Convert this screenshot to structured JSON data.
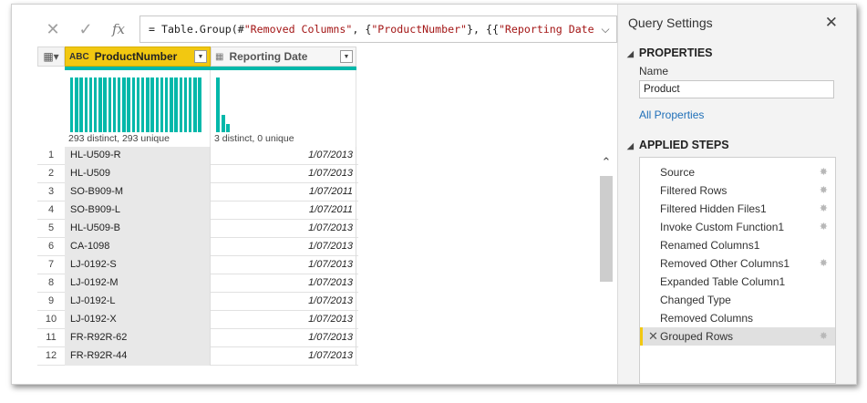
{
  "formula_bar": {
    "cancel_icon": "✕",
    "commit_icon": "✓",
    "fx_label": "fx",
    "formula_parts": [
      "= Table.Group(#",
      "\"Removed Columns\"",
      ", {",
      "\"ProductNumber\"",
      "}, {{",
      "\"Reporting Date\"",
      ","
    ],
    "expand_icon": "chevron-down-icon"
  },
  "table": {
    "columns": [
      {
        "type_icon": "ABC",
        "name": "ProductNumber",
        "selected": true,
        "profile_text": "293 distinct, 293 unique"
      },
      {
        "type_icon": "▦",
        "name": "Reporting Date",
        "selected": false,
        "profile_text": "3 distinct, 0 unique"
      }
    ],
    "col2_profile_levels": [
      1.0,
      0.32,
      0.15
    ],
    "rows": [
      {
        "n": "1",
        "product": "HL-U509-R",
        "date": "1/07/2013"
      },
      {
        "n": "2",
        "product": "HL-U509",
        "date": "1/07/2013"
      },
      {
        "n": "3",
        "product": "SO-B909-M",
        "date": "1/07/2011"
      },
      {
        "n": "4",
        "product": "SO-B909-L",
        "date": "1/07/2011"
      },
      {
        "n": "5",
        "product": "HL-U509-B",
        "date": "1/07/2013"
      },
      {
        "n": "6",
        "product": "CA-1098",
        "date": "1/07/2013"
      },
      {
        "n": "7",
        "product": "LJ-0192-S",
        "date": "1/07/2013"
      },
      {
        "n": "8",
        "product": "LJ-0192-M",
        "date": "1/07/2013"
      },
      {
        "n": "9",
        "product": "LJ-0192-L",
        "date": "1/07/2013"
      },
      {
        "n": "10",
        "product": "LJ-0192-X",
        "date": "1/07/2013"
      },
      {
        "n": "11",
        "product": "FR-R92R-62",
        "date": "1/07/2013"
      },
      {
        "n": "12",
        "product": "FR-R92R-44",
        "date": "1/07/2013"
      }
    ]
  },
  "query_settings": {
    "title": "Query Settings",
    "properties_header": "PROPERTIES",
    "name_label": "Name",
    "name_value": "Product",
    "all_properties_link": "All Properties",
    "applied_steps_header": "APPLIED STEPS",
    "steps": [
      {
        "label": "Source",
        "gear": true
      },
      {
        "label": "Filtered Rows",
        "gear": true
      },
      {
        "label": "Filtered Hidden Files1",
        "gear": true
      },
      {
        "label": "Invoke Custom Function1",
        "gear": true
      },
      {
        "label": "Renamed Columns1",
        "gear": false
      },
      {
        "label": "Removed Other Columns1",
        "gear": true
      },
      {
        "label": "Expanded Table Column1",
        "gear": false
      },
      {
        "label": "Changed Type",
        "gear": false
      },
      {
        "label": "Removed Columns",
        "gear": false
      },
      {
        "label": "Grouped Rows",
        "gear": true,
        "selected": true
      }
    ]
  },
  "colors": {
    "accent_yellow": "#f2c811",
    "profile_teal": "#01b8aa",
    "link_blue": "#1f6fb8"
  }
}
